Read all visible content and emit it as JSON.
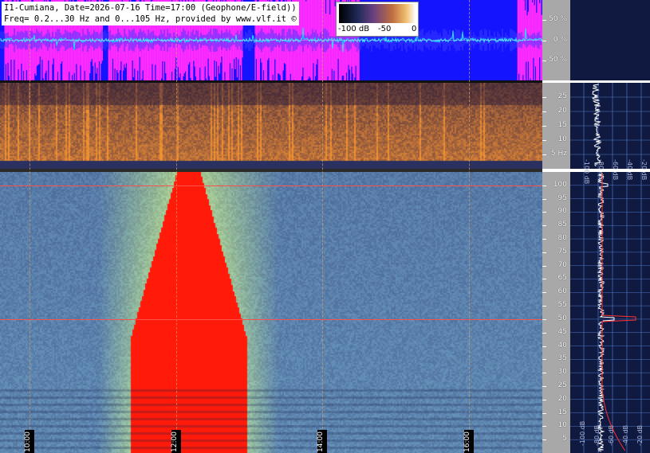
{
  "header": {
    "title_line1": "I1-Cumiana, Date=2026-07-16 Time=17:00 (Geophone/E-field))",
    "title_line2": "Freq= 0.2...30 Hz and 0...105 Hz, provided by www.vlf.it ©"
  },
  "colorbar": {
    "min_label": "-100 dB",
    "mid_label": "-50",
    "max_label": "0"
  },
  "colors": {
    "waveform_bg": "#1414ff",
    "clip_magenta": "#ff2bff",
    "trace_cyan": "#29e0ff",
    "hot_red": "#ff1a0a",
    "axis_gray": "#a8a8a8"
  },
  "chart_data": [
    {
      "type": "line",
      "panel": "waveform",
      "y_ticks": [
        "50 %",
        "0 %",
        "-50 %"
      ],
      "ylim": [
        -100,
        100
      ],
      "clipped_segments": [
        {
          "start": "09:40",
          "end": "11:00"
        },
        {
          "start": "11:05",
          "end": "12:55"
        },
        {
          "start": "13:05",
          "end": "14:30"
        },
        {
          "start": "16:40",
          "end": "17:00"
        }
      ]
    },
    {
      "type": "heatmap",
      "panel": "geophone-spectrogram",
      "ylabel_unit": "Hz",
      "y_ticks": [
        "25",
        "20",
        "15",
        "10",
        "5 Hz"
      ],
      "y_tick_values": [
        25,
        20,
        15,
        10,
        5
      ],
      "ylim": [
        0,
        30
      ]
    },
    {
      "type": "heatmap",
      "panel": "efield-spectrogram",
      "y_ticks": [
        "100",
        "95",
        "90",
        "85",
        "80",
        "75",
        "70",
        "65",
        "60",
        "55",
        "50",
        "45",
        "40",
        "35",
        "30",
        "25",
        "20",
        "15",
        "10",
        "5"
      ],
      "y_tick_values": [
        100,
        95,
        90,
        85,
        80,
        75,
        70,
        65,
        60,
        55,
        50,
        45,
        40,
        35,
        30,
        25,
        20,
        15,
        10,
        5
      ],
      "ylim": [
        0,
        105
      ],
      "x_ticks": [
        "10:00",
        "12:00",
        "14:00",
        "16:00"
      ],
      "xlim_hours": [
        9.6,
        17.0
      ],
      "hot_band": {
        "start": "11:20",
        "peak": "12:10",
        "end": "13:00"
      },
      "hum_lines_hz": [
        50,
        100
      ]
    },
    {
      "type": "line",
      "panel": "average-spectrum",
      "top_x_ticks": [
        "-100 dB",
        "-80 dB",
        "-60 dB",
        "-40 dB",
        "-20 dB"
      ],
      "bottom_x_ticks": [
        "-100 dB",
        "-80 dB",
        "-60 dB",
        "-40 dB",
        "-20 dB"
      ]
    }
  ]
}
